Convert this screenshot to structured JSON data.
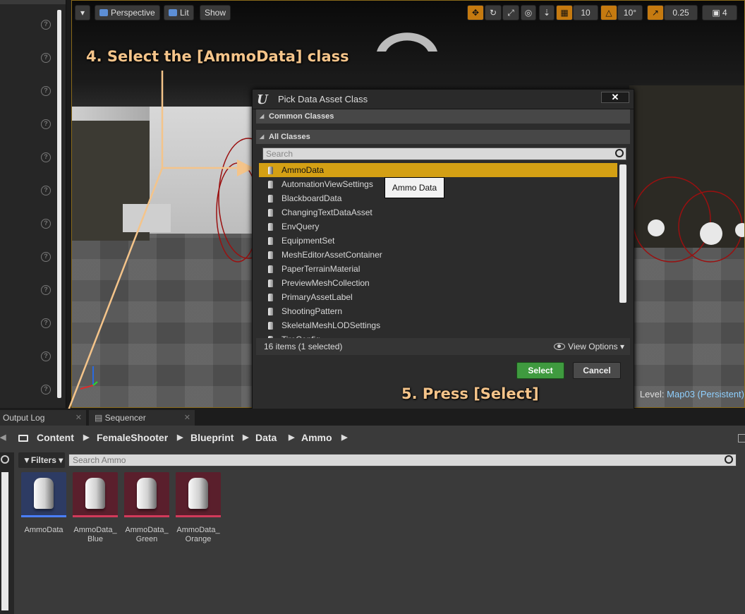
{
  "viewport": {
    "perspective_label": "Perspective",
    "lit_label": "Lit",
    "show_label": "Show",
    "grid_snap": "10",
    "rotation_snap": "10°",
    "scale_snap": "0.25",
    "camera_speed": "4",
    "level_label": "Level:",
    "level_name": "Map03 (Persistent)"
  },
  "annotations": {
    "step4": "4. Select the  [AmmoData] class",
    "step5": "5. Press [Select]"
  },
  "dialog": {
    "title": "Pick Data Asset Class",
    "close_label": "✕",
    "common_classes": "Common Classes",
    "all_classes": "All Classes",
    "search_placeholder": "Search",
    "items": [
      {
        "label": "AmmoData",
        "selected": true
      },
      {
        "label": "AutomationViewSettings"
      },
      {
        "label": "BlackboardData"
      },
      {
        "label": "ChangingTextDataAsset"
      },
      {
        "label": "EnvQuery"
      },
      {
        "label": "EquipmentSet"
      },
      {
        "label": "MeshEditorAssetContainer"
      },
      {
        "label": "PaperTerrainMaterial"
      },
      {
        "label": "PreviewMeshCollection"
      },
      {
        "label": "PrimaryAssetLabel"
      },
      {
        "label": "ShootingPattern"
      },
      {
        "label": "SkeletalMeshLODSettings"
      },
      {
        "label": "TireConfig"
      }
    ],
    "tooltip": "Ammo Data",
    "status": "16 items (1 selected)",
    "view_options": "View Options",
    "select_label": "Select",
    "cancel_label": "Cancel"
  },
  "tabs": [
    {
      "label": "Output Log"
    },
    {
      "label": "Sequencer"
    }
  ],
  "content_browser": {
    "breadcrumbs": [
      "Content",
      "FemaleShooter",
      "Blueprint",
      "Data",
      "Ammo"
    ],
    "filters_label": "Filters",
    "search_placeholder": "Search Ammo",
    "assets": [
      {
        "name": "AmmoData",
        "bg": "#2d3b63",
        "bar": "#4a7fff"
      },
      {
        "name": "AmmoData_\nBlue",
        "bg": "#5a1f2c",
        "bar": "#d23a5a"
      },
      {
        "name": "AmmoData_\nGreen",
        "bg": "#5a1f2c",
        "bar": "#d23a5a"
      },
      {
        "name": "AmmoData_\nOrange",
        "bg": "#5a1f2c",
        "bar": "#d23a5a"
      }
    ]
  },
  "colors": {
    "selection": "#d4a014",
    "select_button": "#3f9a3f",
    "annotation": "#f4c48a"
  }
}
